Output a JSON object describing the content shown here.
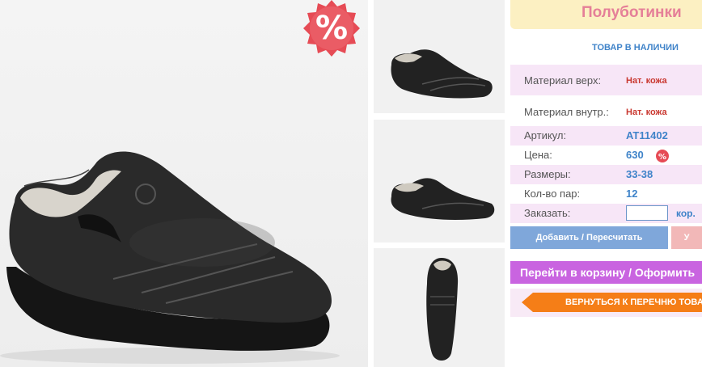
{
  "product": {
    "title": "Полуботинки",
    "stock_status": "ТОВАР В НАЛИЧИИ"
  },
  "sale_badge": "%",
  "details": {
    "material_top_label": "Материал верх:",
    "material_top_value": "Нат. кожа",
    "material_inner_label": "Материал внутр.:",
    "material_inner_value": "Нат. кожа",
    "article_label": "Артикул:",
    "article_value": "AT11402",
    "price_label": "Цена:",
    "price_value": "630",
    "sizes_label": "Размеры:",
    "sizes_value": "33-38",
    "pairs_label": "Кол-во пар:",
    "pairs_value": "12",
    "order_label": "Заказать:",
    "order_unit": "кор."
  },
  "buttons": {
    "add_recalc": "Добавить / Пересчитать",
    "second_action": "У",
    "go_to_cart": "Перейти в корзину / Оформить",
    "back_to_list": "ВЕРНУТЬСЯ К ПЕРЕЧНЮ ТОВАРОВ"
  },
  "colors": {
    "accent_blue": "#3f83c9",
    "title_pink": "#e57f98",
    "badge_red": "#e64b55",
    "cart_purple": "#c964e0",
    "back_orange": "#f57e17"
  }
}
